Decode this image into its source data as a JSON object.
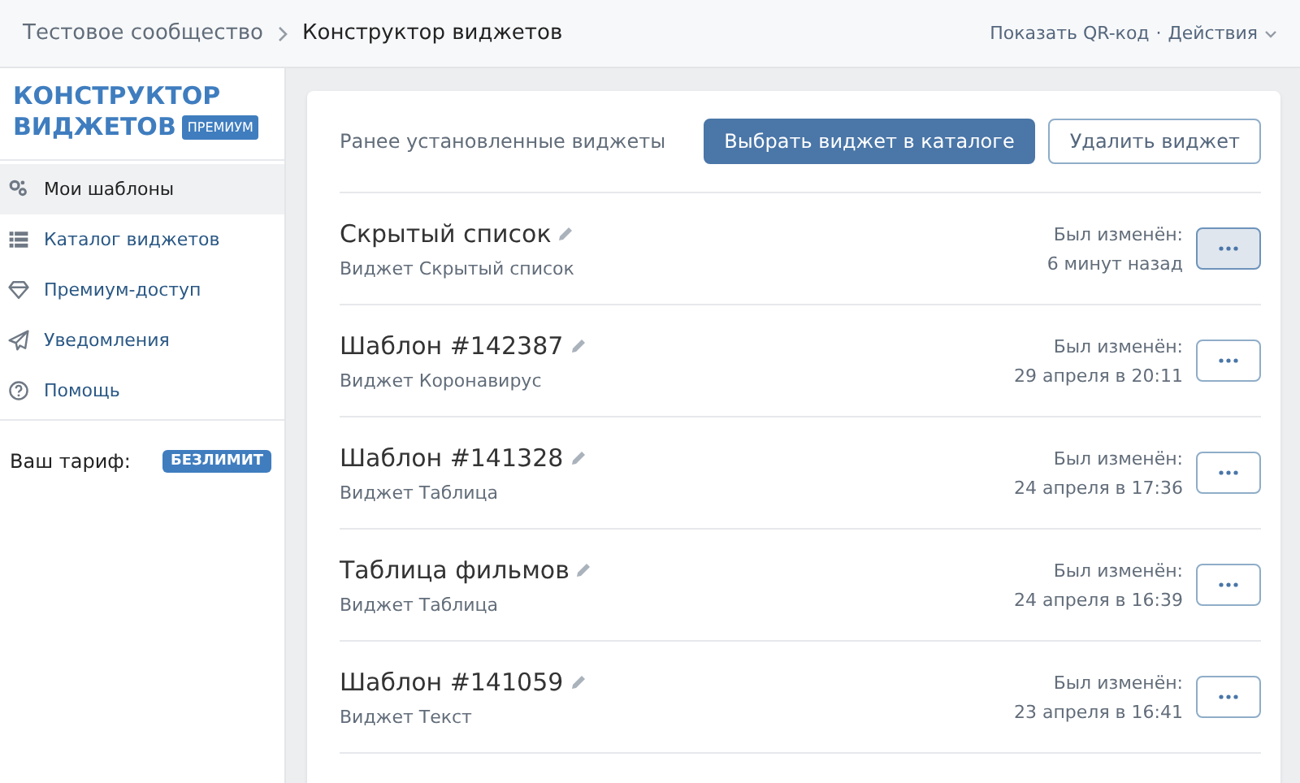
{
  "breadcrumbs": {
    "parent": "Тестовое сообщество",
    "current": "Конструктор виджетов"
  },
  "header_actions": {
    "qr": "Показать QR-код",
    "separator": "·",
    "actions": "Действия"
  },
  "sidebar": {
    "logo": {
      "line1": "КОНСТРУКТОР",
      "line2": "ВИДЖЕТОВ",
      "badge": "ПРЕМИУМ"
    },
    "items": [
      {
        "label": "Мои шаблоны",
        "selected": true
      },
      {
        "label": "Каталог виджетов",
        "selected": false
      },
      {
        "label": "Премиум-доступ",
        "selected": false
      },
      {
        "label": "Уведомления",
        "selected": false
      },
      {
        "label": "Помощь",
        "selected": false
      }
    ],
    "tariff": {
      "label": "Ваш тариф:",
      "badge": "БЕЗЛИМИТ"
    }
  },
  "panel": {
    "title": "Ранее установленные виджеты",
    "primary_button": "Выбрать виджет в каталоге",
    "secondary_button": "Удалить виджет",
    "widgets": [
      {
        "name": "Скрытый список",
        "type": "Виджет Скрытый список",
        "modified_label": "Был изменён:",
        "modified": "6 минут назад",
        "hovered": true
      },
      {
        "name": "Шаблон #142387",
        "type": "Виджет Коронавирус",
        "modified_label": "Был изменён:",
        "modified": "29 апреля в 20:11",
        "hovered": false
      },
      {
        "name": "Шаблон #141328",
        "type": "Виджет Таблица",
        "modified_label": "Был изменён:",
        "modified": "24 апреля в 17:36",
        "hovered": false
      },
      {
        "name": "Таблица фильмов",
        "type": "Виджет Таблица",
        "modified_label": "Был изменён:",
        "modified": "24 апреля в 16:39",
        "hovered": false
      },
      {
        "name": "Шаблон #141059",
        "type": "Виджет Текст",
        "modified_label": "Был изменён:",
        "modified": "23 апреля в 16:41",
        "hovered": false
      }
    ]
  }
}
